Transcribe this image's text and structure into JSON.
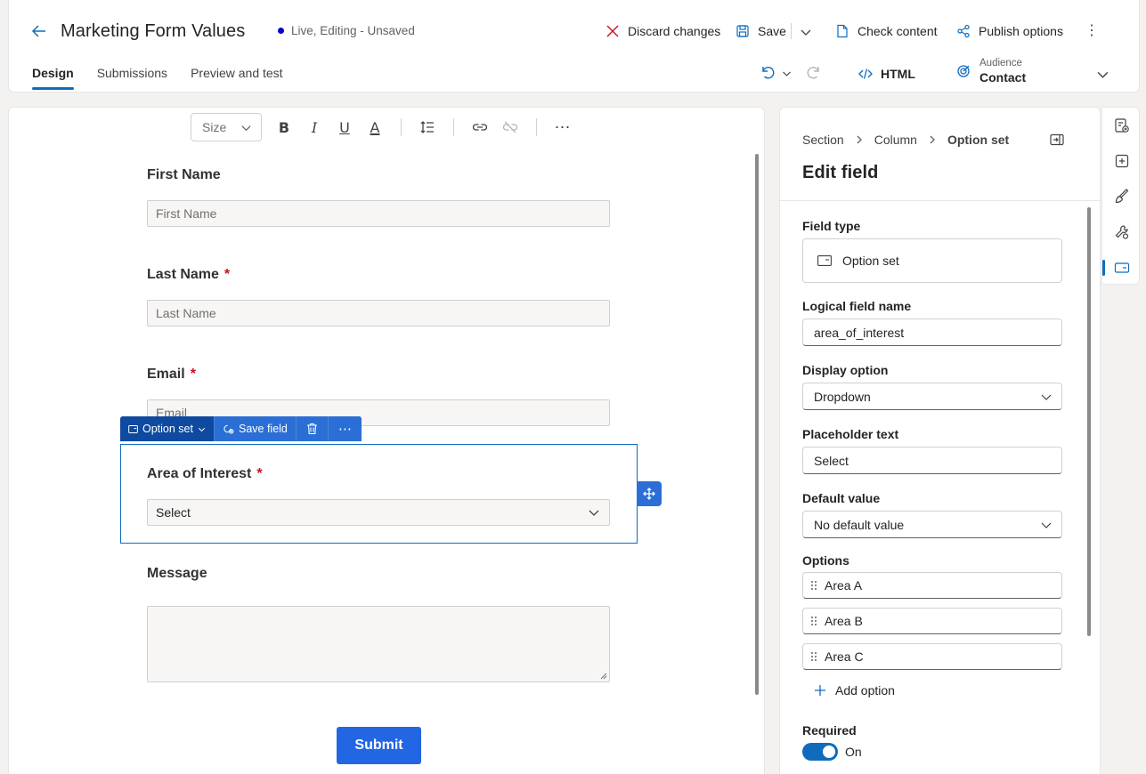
{
  "header": {
    "title": "Marketing Form Values",
    "status": "Live, Editing - Unsaved",
    "discard_label": "Discard changes",
    "save_label": "Save",
    "check_label": "Check content",
    "publish_label": "Publish options",
    "html_label": "HTML",
    "audience_label": "Audience",
    "audience_value": "Contact",
    "tabs": [
      {
        "label": "Design",
        "active": true
      },
      {
        "label": "Submissions",
        "active": false
      },
      {
        "label": "Preview and test",
        "active": false
      }
    ]
  },
  "toolbar": {
    "size_placeholder": "Size"
  },
  "form": {
    "first_name_label": "First Name",
    "first_name_placeholder": "First Name",
    "last_name_label": "Last Name",
    "last_name_placeholder": "Last Name",
    "email_label": "Email",
    "email_placeholder": "Email",
    "area_label": "Area of Interest",
    "area_value": "Select",
    "message_label": "Message",
    "required_mark": "*",
    "submit_label": "Submit"
  },
  "field_bar": {
    "type_label": "Option set",
    "save_field_label": "Save field"
  },
  "panel": {
    "breadcrumb": [
      "Section",
      "Column",
      "Option set"
    ],
    "title": "Edit field",
    "field_type_label": "Field type",
    "field_type_value": "Option set",
    "logical_name_label": "Logical field name",
    "logical_name_value": "area_of_interest",
    "display_option_label": "Display option",
    "display_option_value": "Dropdown",
    "placeholder_label": "Placeholder text",
    "placeholder_value": "Select",
    "default_label": "Default value",
    "default_value": "No default value",
    "options_label": "Options",
    "options": [
      "Area A",
      "Area B",
      "Area C"
    ],
    "add_option_label": "Add option",
    "required_label": "Required",
    "required_state": "On"
  },
  "colors": {
    "accent": "#0f6cbd",
    "submit": "#2266e3",
    "required": "#c50f1f",
    "status_dot": "#0000cc"
  }
}
